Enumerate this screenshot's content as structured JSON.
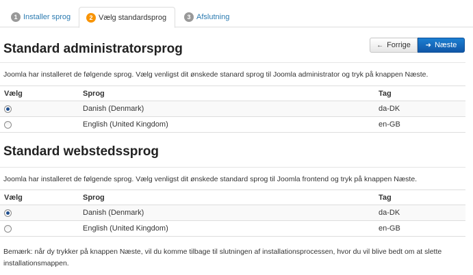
{
  "tabs": [
    {
      "num": "1",
      "label": "Installer sprog"
    },
    {
      "num": "2",
      "label": "Vælg standardsprog"
    },
    {
      "num": "3",
      "label": "Afslutning"
    }
  ],
  "buttons": {
    "prev_label": "Forrige",
    "next_label": "Næste"
  },
  "admin": {
    "title": "Standard administratorsprog",
    "intro": "Joomla har installeret de følgende sprog. Vælg venligst dit ønskede stanard sprog til Joomla administrator og tryk på knappen Næste.",
    "columns": [
      "Vælg",
      "Sprog",
      "Tag"
    ],
    "rows": [
      {
        "language": "Danish (Denmark)",
        "tag": "da-DK",
        "selected": true
      },
      {
        "language": "English (United Kingdom)",
        "tag": "en-GB",
        "selected": false
      }
    ]
  },
  "site": {
    "title": "Standard webstedssprog",
    "intro": "Joomla har installeret de følgende sprog. Vælg venligst dit ønskede standard sprog til Joomla frontend og tryk på knappen Næste.",
    "columns": [
      "Vælg",
      "Sprog",
      "Tag"
    ],
    "rows": [
      {
        "language": "Danish (Denmark)",
        "tag": "da-DK",
        "selected": true
      },
      {
        "language": "English (United Kingdom)",
        "tag": "en-GB",
        "selected": false
      }
    ]
  },
  "note": "Bemærk: når dy trykker på knappen Næste, vil du komme tilbage til slutningen af installationsprocessen, hvor du vil blive bedt om at slette installationsmappen.",
  "colors": {
    "link": "#2a7ab0",
    "active_step": "#f89406",
    "inactive_step": "#999999",
    "primary_button": "#1567bd"
  }
}
